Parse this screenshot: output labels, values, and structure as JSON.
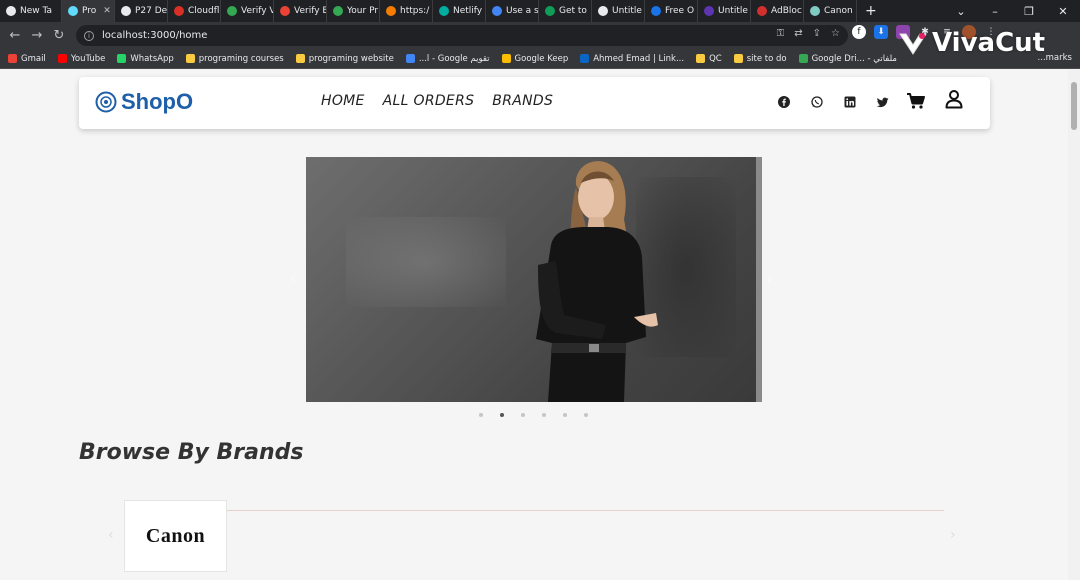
{
  "browser": {
    "tabs": [
      {
        "label": "New Ta",
        "color": "#e8eaed",
        "active": false
      },
      {
        "label": "Pro",
        "color": "#61dafb",
        "active": true
      },
      {
        "label": "P27 De",
        "color": "#e8eaed",
        "active": false
      },
      {
        "label": "Cloudfl",
        "color": "#d93025",
        "active": false
      },
      {
        "label": "Verify V",
        "color": "#34a853",
        "active": false
      },
      {
        "label": "Verify E",
        "color": "#ea4335",
        "active": false
      },
      {
        "label": "Your Pr",
        "color": "#34a853",
        "active": false
      },
      {
        "label": "https:/",
        "color": "#f57c00",
        "active": false
      },
      {
        "label": "Netlify",
        "color": "#00ad9f",
        "active": false
      },
      {
        "label": "Use a s",
        "color": "#4285f4",
        "active": false
      },
      {
        "label": "Get to",
        "color": "#0f9d58",
        "active": false
      },
      {
        "label": "Untitle",
        "color": "#e8eaed",
        "active": false
      },
      {
        "label": "Free O",
        "color": "#1a73e8",
        "active": false
      },
      {
        "label": "Untitle",
        "color": "#5e35b1",
        "active": false
      },
      {
        "label": "AdBloc",
        "color": "#d32f2f",
        "active": false
      },
      {
        "label": "Canon",
        "color": "#80cbc4",
        "active": false
      }
    ],
    "new_tab": "+",
    "url": "localhost:3000/home",
    "bookmarks": [
      {
        "label": "Gmail",
        "color": "#ea4335"
      },
      {
        "label": "YouTube",
        "color": "#ff0000"
      },
      {
        "label": "WhatsApp",
        "color": "#25d366"
      },
      {
        "label": "programing courses",
        "color": "#f9cb40"
      },
      {
        "label": "programing website",
        "color": "#f9cb40"
      },
      {
        "label": "...l - Google تقويم",
        "color": "#4285f4"
      },
      {
        "label": "Google Keep",
        "color": "#fbbc04"
      },
      {
        "label": "Ahmed Emad | Link...",
        "color": "#0a66c2"
      },
      {
        "label": "QC",
        "color": "#f9cb40"
      },
      {
        "label": "site to do",
        "color": "#f9cb40"
      },
      {
        "label": "Google Dri... - ملفاتي",
        "color": "#34a853"
      }
    ],
    "bookmarks_right": "...marks",
    "watermark": "VivaCut"
  },
  "site": {
    "logo": "ShopO",
    "nav": [
      "HOME",
      "ALL ORDERS",
      "BRANDS"
    ],
    "social_icons": [
      "facebook-icon",
      "whatsapp-icon",
      "linkedin-icon",
      "twitter-icon"
    ],
    "slider": {
      "slide_count": 6,
      "active_index": 1
    },
    "section_title": "Browse By Brands",
    "brands": [
      {
        "name": "Canon"
      }
    ]
  }
}
